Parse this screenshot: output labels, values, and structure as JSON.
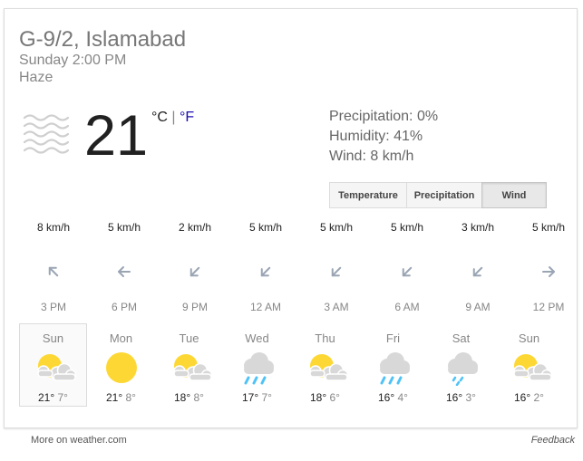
{
  "header": {
    "location": "G-9/2, Islamabad",
    "datetime": "Sunday 2:00 PM",
    "condition": "Haze"
  },
  "current": {
    "icon": "haze-icon",
    "temperature": "21",
    "unit_c": "°C",
    "unit_sep": "|",
    "unit_f": "°F"
  },
  "details": {
    "precipitation": "Precipitation: 0%",
    "humidity": "Humidity: 41%",
    "wind": "Wind: 8 km/h"
  },
  "tabs": [
    {
      "label": "Temperature",
      "active": false
    },
    {
      "label": "Precipitation",
      "active": false
    },
    {
      "label": "Wind",
      "active": true
    }
  ],
  "wind": [
    {
      "speed": "8 km/h",
      "time": "3 PM",
      "direction": "up-left"
    },
    {
      "speed": "5 km/h",
      "time": "6 PM",
      "direction": "left"
    },
    {
      "speed": "2 km/h",
      "time": "9 PM",
      "direction": "down-left"
    },
    {
      "speed": "5 km/h",
      "time": "12 AM",
      "direction": "down-left"
    },
    {
      "speed": "5 km/h",
      "time": "3 AM",
      "direction": "down-left"
    },
    {
      "speed": "5 km/h",
      "time": "6 AM",
      "direction": "down-left"
    },
    {
      "speed": "3 km/h",
      "time": "9 AM",
      "direction": "down-left"
    },
    {
      "speed": "5 km/h",
      "time": "12 PM",
      "direction": "right"
    }
  ],
  "forecast": [
    {
      "day": "Sun",
      "icon": "partly-cloudy-icon",
      "high": "21°",
      "low": "7°",
      "selected": true
    },
    {
      "day": "Mon",
      "icon": "sunny-icon",
      "high": "21°",
      "low": "8°",
      "selected": false
    },
    {
      "day": "Tue",
      "icon": "partly-cloudy-icon",
      "high": "18°",
      "low": "8°",
      "selected": false
    },
    {
      "day": "Wed",
      "icon": "rain-icon",
      "high": "17°",
      "low": "7°",
      "selected": false
    },
    {
      "day": "Thu",
      "icon": "partly-cloudy-icon",
      "high": "18°",
      "low": "6°",
      "selected": false
    },
    {
      "day": "Fri",
      "icon": "rain-icon",
      "high": "16°",
      "low": "4°",
      "selected": false
    },
    {
      "day": "Sat",
      "icon": "light-rain-icon",
      "high": "16°",
      "low": "3°",
      "selected": false
    },
    {
      "day": "Sun",
      "icon": "partly-cloudy-icon",
      "high": "16°",
      "low": "2°",
      "selected": false
    }
  ],
  "footer": {
    "source_link": "More on weather.com",
    "feedback_link": "Feedback"
  },
  "colors": {
    "sun": "#fdd835",
    "cloud": "#d8d8d8",
    "rain": "#4fc3f7",
    "link": "#1a0dab",
    "arrow": "#9aa5b4"
  }
}
